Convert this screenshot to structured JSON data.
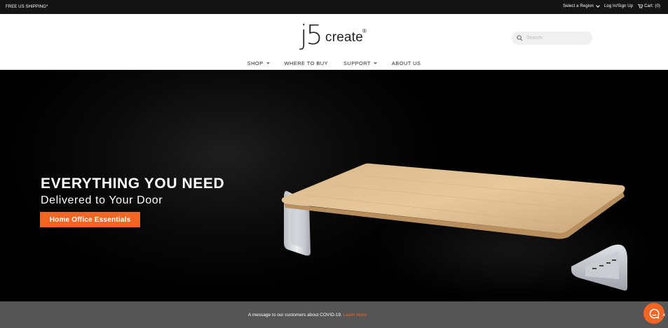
{
  "topbar": {
    "promo": "FREE US SHIPPING*",
    "region": "Select a Region",
    "login": "Log In/Sign Up",
    "cart": "Cart: (0)"
  },
  "header": {
    "logo_main": "j5",
    "logo_sub": "create",
    "logo_mark": "®",
    "search_placeholder": "Search"
  },
  "nav": [
    {
      "label": "SHOP",
      "dropdown": true
    },
    {
      "label": "WHERE TO BUY",
      "dropdown": false
    },
    {
      "label": "SUPPORT",
      "dropdown": true
    },
    {
      "label": "ABOUT US",
      "dropdown": false
    }
  ],
  "hero": {
    "headline": "EVERYTHING YOU NEED",
    "subheadline": "Delivered to Your Door",
    "cta": "Home Office Essentials"
  },
  "covid": {
    "message": "A message to our customers about COVID-19.",
    "link": "Learn More"
  },
  "chat": {
    "close": "×"
  },
  "colors": {
    "accent": "#f26522",
    "topbar": "#141414",
    "covid_bar": "#555555"
  }
}
